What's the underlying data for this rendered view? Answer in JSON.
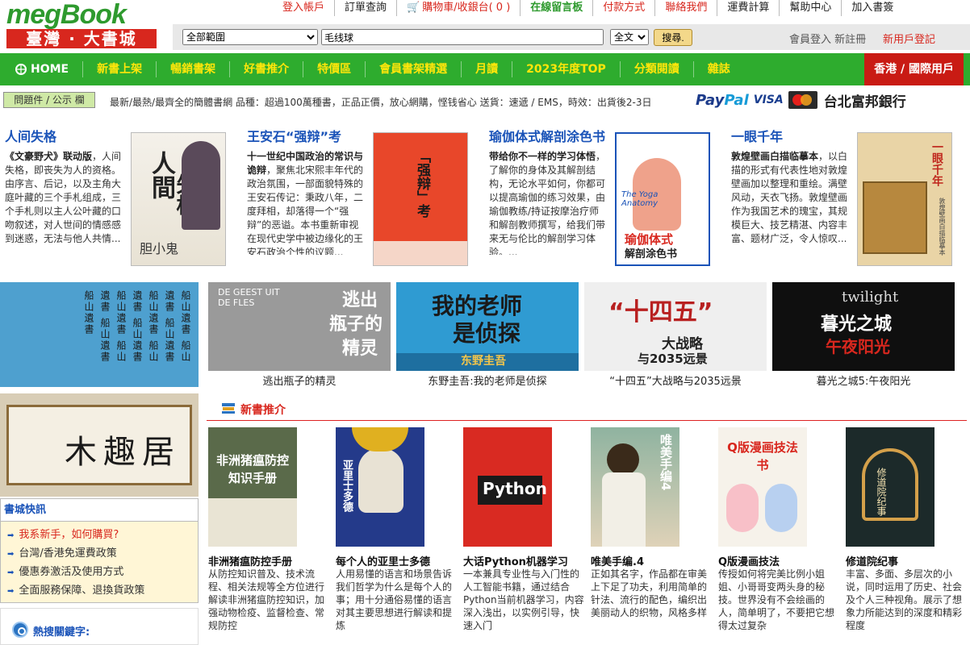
{
  "logo": {
    "line1": "megBook",
    "line2": "臺灣 · 大書城"
  },
  "toplinks": [
    "登入帳戶",
    "訂單查詢",
    "購物車/收銀台( 0 )",
    "在線留言板",
    "付款方式",
    "聯絡我們",
    "運費計算",
    "幫助中心",
    "加入書簽"
  ],
  "colors": {
    "green": "#2eac2e",
    "red": "#d8271e",
    "yellow": "#ffe60a",
    "blue": "#1a53b8"
  },
  "search": {
    "scope": "全部範圍",
    "query": "毛线球",
    "type": "全文",
    "button": "搜尋.",
    "login": "會員登入 新註冊",
    "signup": "新用戶登記"
  },
  "nav": {
    "home": "HOME",
    "items": [
      "新書上架",
      "暢銷書架",
      "好書推介",
      "特價區",
      "會員書架精選",
      "月讀",
      "2023年度TOP",
      "分類閱讀",
      "雜誌"
    ],
    "intl": "香港 / 國際用戶"
  },
  "bulletin": {
    "button": "問題件 / 公示 欄",
    "text": "最新/最熱/最齊全的簡體書網    品種：超過100萬種書，正品正價，放心網購，悭钱省心    送貨：速遞 / EMS，時效：出貨後2-3日",
    "paypal1": "Pay",
    "paypal2": "Pal",
    "visa": "VISA",
    "bank": "台北富邦銀行"
  },
  "featured": [
    {
      "title": "人间失格",
      "bold": "《文豪野犬》联动版",
      "desc": "，人间失格，即丧失为人的资格。由序言、后记，以及主角大庭叶藏的三个手札组成，三个手札则以主人公叶藏的口吻叙述，对人世间的情感感到迷惑，无法与他人共情..."
    },
    {
      "title": "王安石“强辩”考",
      "bold": "十一世纪中国政治的常识与诡辩",
      "desc": "，聚焦北宋熙丰年代的政治氛围，一部面貌特殊的王安石传记：秉政八年，二度拜相，却落得一个“强辩”的恶谥。本书重新审视在现代史学中被边缘化的王安石政治个性的议题..."
    },
    {
      "title": "瑜伽体式解剖涂色书",
      "bold": "带给你不一样的学习体悟",
      "desc": "，了解你的身体及其解剖结构，无论水平如何，你都可以提高瑜伽的练习效果，由瑜伽教练/持证按摩治疗师和解剖教师撰写，给我们带来无与伦比的解剖学习体验。..."
    },
    {
      "title": "一眼千年",
      "bold": "敦煌壁画白描临摹本",
      "desc": "，以白描的形式有代表性地对敦煌壁画加以整理和重绘。满壁风动，天衣飞扬。敦煌壁画作为我国艺术的瑰宝，其规模巨大、技艺精湛、内容丰富、题材广泛，令人惊叹..."
    }
  ],
  "covers": {
    "c1a": "人間",
    "c1b": "失格",
    "c1c": "胆小鬼",
    "c2": "「强辩」考",
    "c3a": "The Yoga Anatomy",
    "c3b": "瑜伽体式",
    "c3c": "解剖涂色书",
    "c4a": "一眼千年",
    "c4b": "敦煌壁画白描临摹本"
  },
  "banners": [
    {
      "caption": "逃出瓶子的精灵",
      "t1": "逃出",
      "t2": "瓶子的",
      "t3": "精灵",
      "en": "DE GEEST UIT DE FLES"
    },
    {
      "caption": "东野圭吾:我的老师是侦探",
      "t1": "我的老师",
      "t2": "是侦探",
      "t3": "东野圭吾"
    },
    {
      "caption": "“十四五”大战略与2035远景",
      "t1": "“十四五”",
      "t2": "大战略",
      "t3": "与2035远景"
    },
    {
      "caption": "暮光之城5:午夜阳光",
      "t1": "twilight",
      "t2": "暮光之城",
      "t3": "午夜阳光"
    }
  ],
  "leftbanners": {
    "top": "船山遺書",
    "bottom": "木趣居"
  },
  "news": {
    "title": "書城快訊",
    "items": [
      "我系新手，如何購買?",
      "台灣/香港免運費政策",
      "優惠券激活及使用方式",
      "全面服務保障、退換貨政策"
    ]
  },
  "hot": "熱搜關鍵字:",
  "newbooks": {
    "heading": "新書推介",
    "items": [
      {
        "title": "非洲猪瘟防控手册",
        "desc": "从防控知识普及、技术流程、相关法规等全方位进行解读非洲猪瘟防控知识，加强动物检疫、监督检查、常规防控",
        "cv": "非洲猪瘟防控知识手册"
      },
      {
        "title": "每个人的亚里士多德",
        "desc": "人用易懂的语言和场景告诉我们哲学为什么是每个人的事；用十分通俗易懂的语言对其主要思想进行解读和提炼",
        "cv": "亚里士多德"
      },
      {
        "title": "大话Python机器学习",
        "desc": "一本兼具专业性与入门性的人工智能书籍，通过结合Python当前机器学习，内容深入浅出，以实例引导，快速入门",
        "cv": "Python"
      },
      {
        "title": "唯美手编.4",
        "desc": "正如其名字，作品都在审美上下足了功夫，利用简单的针法、流行的配色，编织出美丽动人的织物，风格多样",
        "cv": "唯美手编4"
      },
      {
        "title": "Q版漫画技法",
        "desc": "传授如何将完美比例小姐姐、小哥哥变两头身的秘技。世界没有不会绘画的人，简单明了，不要把它想得太过复杂",
        "cv": "Q版漫画技法书"
      },
      {
        "title": "修道院纪事",
        "desc": "丰富、多面、多层次的小说，同时运用了历史、社会及个人三种视角。展示了想象力所能达到的深度和精彩程度",
        "cv": "修道院纪事"
      }
    ]
  }
}
